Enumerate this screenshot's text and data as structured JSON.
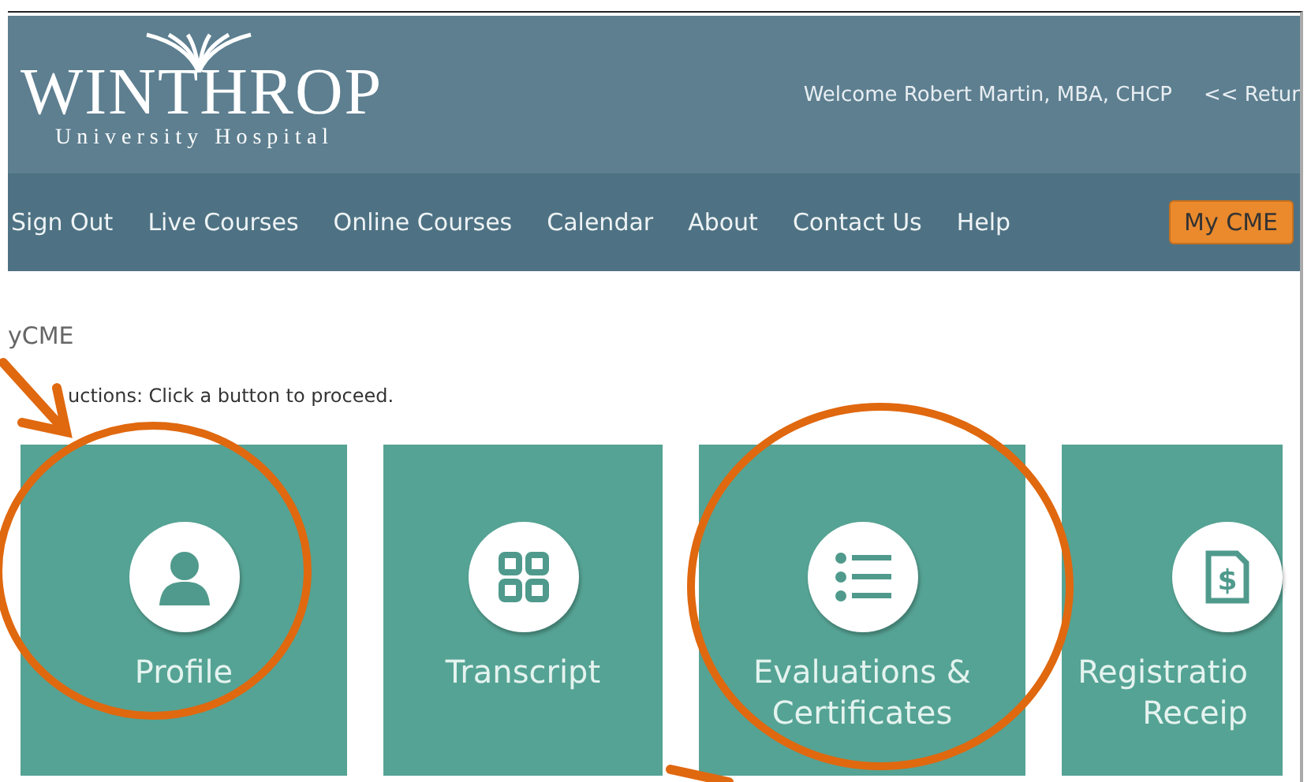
{
  "header": {
    "logo": {
      "name": "WINTHROP",
      "subtitle": "University Hospital"
    },
    "welcome": "Welcome Robert Martin, MBA, CHCP",
    "return_link": "<< Retur"
  },
  "nav": {
    "items": [
      "Sign Out",
      "Live Courses",
      "Online Courses",
      "Calendar",
      "About",
      "Contact Us",
      "Help"
    ],
    "button": "My CME"
  },
  "page": {
    "title": "yCME",
    "instructions": "uctions: Click a button to proceed."
  },
  "tiles": [
    {
      "kind": "profile",
      "label": [
        "Profile"
      ]
    },
    {
      "kind": "transcript",
      "label": [
        "Transcript"
      ]
    },
    {
      "kind": "evaluations",
      "label": [
        "Evaluations &",
        "Certificates"
      ]
    },
    {
      "kind": "receipt",
      "icon_text": "$",
      "label": [
        "Registratio",
        "Receip"
      ]
    }
  ]
}
